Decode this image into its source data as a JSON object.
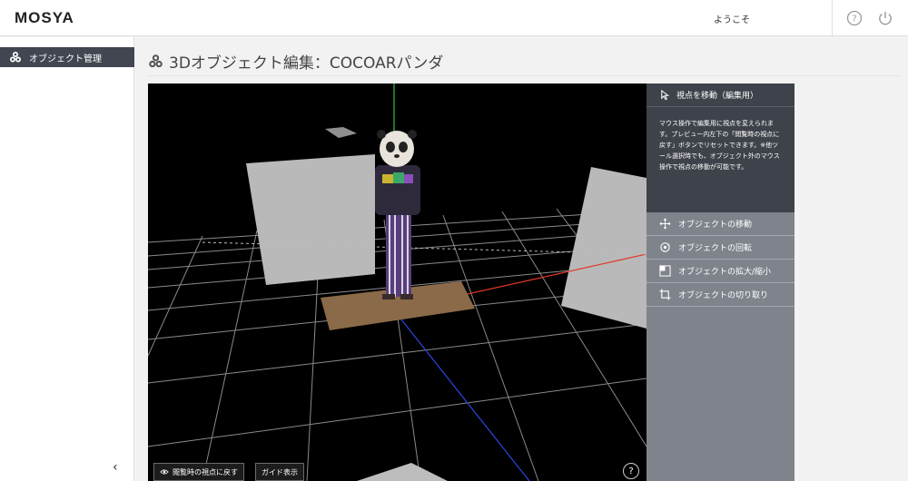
{
  "header": {
    "logo": "MOSYA",
    "welcome": "ようこそ",
    "help_icon": "help-circle-icon",
    "power_icon": "power-icon"
  },
  "sidebar": {
    "items": [
      {
        "label": "オブジェクト管理",
        "icon": "objects-icon"
      }
    ],
    "collapse_glyph": "‹"
  },
  "page": {
    "title": "3Dオブジェクト編集：COCOARパンダ"
  },
  "viewer": {
    "reset_view_label": "閲覧時の視点に戻す",
    "guide_label": "ガイド表示",
    "help_glyph": "?"
  },
  "tools": {
    "active": {
      "label": "視点を移動（編集用）",
      "description": "マウス操作で編集用に視点を変えられます。プレビュー内左下の「閲覧時の視点に戻す」ボタンでリセットできます。※他ツール選択時でも、オブジェクト外のマウス操作で視点の移動が可能です。"
    },
    "items": [
      {
        "label": "オブジェクトの移動",
        "icon": "move-icon"
      },
      {
        "label": "オブジェクトの回転",
        "icon": "rotate-icon"
      },
      {
        "label": "オブジェクトの拡大/縮小",
        "icon": "scale-icon"
      },
      {
        "label": "オブジェクトの切り取り",
        "icon": "crop-icon"
      }
    ]
  },
  "colors": {
    "sidebar_active": "#424650",
    "tool_active": "#3e424a",
    "tool_panel": "#7f838c",
    "axis_x": "#e03a2a",
    "axis_y": "#2ec34a",
    "axis_z": "#2b46e0"
  }
}
